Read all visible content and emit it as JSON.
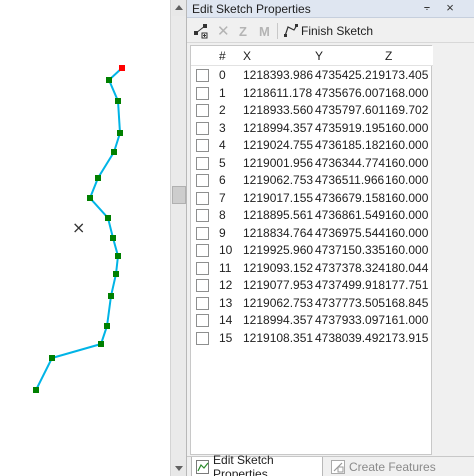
{
  "panel": {
    "title": "Edit Sketch Properties",
    "pin_glyph": "⨪",
    "close_glyph": "×"
  },
  "toolbar": {
    "insert_vertex_icon": "insert-vertex-icon",
    "delete_vertex_icon": "delete-icon",
    "z_label": "Z",
    "m_label": "M",
    "finish_sketch_label": "Finish Sketch"
  },
  "grid": {
    "columns": [
      "#",
      "X",
      "Y",
      "Z"
    ],
    "rows": [
      {
        "id": "0",
        "x": "1218393.986",
        "y": "4735425.219",
        "z": "173.405"
      },
      {
        "id": "1",
        "x": "1218611.178",
        "y": "4735676.007",
        "z": "168.000"
      },
      {
        "id": "2",
        "x": "1218933.560",
        "y": "4735797.601",
        "z": "169.702"
      },
      {
        "id": "3",
        "x": "1218994.357",
        "y": "4735919.195",
        "z": "160.000"
      },
      {
        "id": "4",
        "x": "1219024.755",
        "y": "4736185.182",
        "z": "160.000"
      },
      {
        "id": "5",
        "x": "1219001.956",
        "y": "4736344.774",
        "z": "160.000"
      },
      {
        "id": "6",
        "x": "1219062.753",
        "y": "4736511.966",
        "z": "160.000"
      },
      {
        "id": "7",
        "x": "1219017.155",
        "y": "4736679.158",
        "z": "160.000"
      },
      {
        "id": "8",
        "x": "1218895.561",
        "y": "4736861.549",
        "z": "160.000"
      },
      {
        "id": "9",
        "x": "1218834.764",
        "y": "4736975.544",
        "z": "160.000"
      },
      {
        "id": "10",
        "x": "1219925.960",
        "y": "4737150.335",
        "z": "160.000"
      },
      {
        "id": "11",
        "x": "1219093.152",
        "y": "4737378.324",
        "z": "180.044"
      },
      {
        "id": "12",
        "x": "1219077.953",
        "y": "4737499.918",
        "z": "177.751"
      },
      {
        "id": "13",
        "x": "1219062.753",
        "y": "4737773.505",
        "z": "168.845"
      },
      {
        "id": "14",
        "x": "1218994.357",
        "y": "4737933.097",
        "z": "161.000"
      },
      {
        "id": "15",
        "x": "1219108.351",
        "y": "4738039.492",
        "z": "173.915"
      }
    ]
  },
  "tabs": [
    {
      "label": "Edit Sketch Properties",
      "active": true
    },
    {
      "label": "Create Features",
      "active": false
    }
  ],
  "map": {
    "line_color": "#00b4e6",
    "vertex_color": "#008000",
    "selected_vertex_color": "#ff0000",
    "cursor_glyph": "×"
  }
}
